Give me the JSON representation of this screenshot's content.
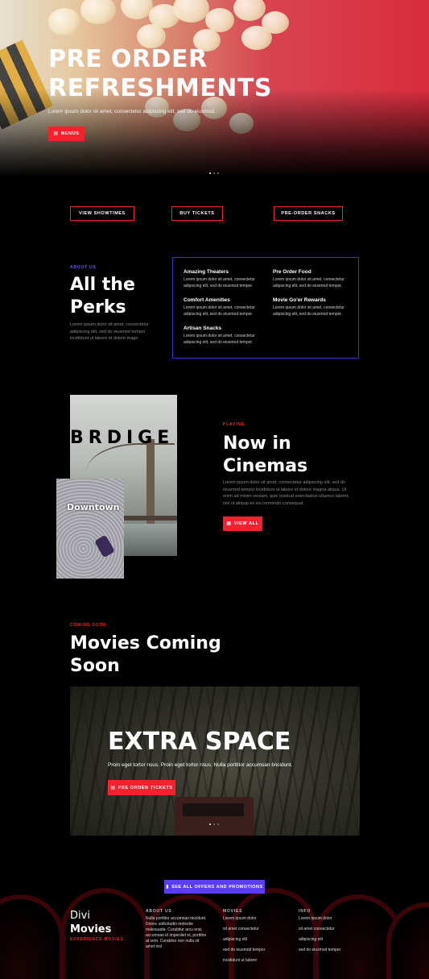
{
  "hero": {
    "title": "PRE ORDER REFRESHMENTS",
    "subtitle": "Lorem ipsum dolor sit amet, consectetur adipiscing elit, sed do eiusmod.",
    "button_label": "MENUS"
  },
  "quick_links": [
    "VIEW SHOWTIMES",
    "BUY TICKETS",
    "PRE-ORDER SNACKS"
  ],
  "perks": {
    "eyebrow": "ABOUT US",
    "title_light": "All the",
    "title_bold": "Perks",
    "description": "Lorem ipsum dolor sit amet, consectetur adipiscing elit, sed do eiusmod tempor incididunt ut labore et dolore magn",
    "items": [
      {
        "title": "Amazing Theaters",
        "text": "Lorem ipsum dolor sit amet, consectetur adipiscing elit, sed do eiusmod tempor."
      },
      {
        "title": "Pre Order Food",
        "text": "Lorem ipsum dolor sit amet, consectetur adipiscing elit, sed do eiusmod tempor."
      },
      {
        "title": "Comfort Amenities",
        "text": "Lorem ipsum dolor sit amet, consectetur adipiscing elit, sed do eiusmod tempor."
      },
      {
        "title": "Movie Go'er Rewards",
        "text": "Lorem ipsum dolor sit amet, consectetur adipiscing elit, sed do eiusmod tempor."
      },
      {
        "title": "Artisan Snacks",
        "text": "Lorem ipsum dolor sit amet, consectetur adipiscing elit, sed do eiusmod tempor."
      }
    ]
  },
  "cinemas": {
    "poster_bridge_word": "BRDIGE",
    "poster_downtown_word": "Downtown",
    "eyebrow": "PLAYING",
    "title_light": "Now in",
    "title_bold": "Cinemas",
    "description": "Lorem ipsum dolor sit amet, consectetur adipiscing elit, sed do eiusmod tempor incididunt ut labore et dolore magna aliqua. Ut enim ad minim veniam, quis nostrud exercitation ullamco laboris nisi ut aliquip ex ea commodo consequat.",
    "button_label": "VIEW ALL"
  },
  "coming_soon": {
    "eyebrow": "COMING SOON",
    "title_light": "Movies",
    "title_bold": "Coming Soon",
    "feature_title": "EXTRA SPACE",
    "feature_subtitle": "Proin eget tortor risus. Proin eget tortor risus. Nulla porttitor accumsan tincidunt.",
    "feature_button": "PRE ORDER TICKETS"
  },
  "footer": {
    "promo_button": "SEE ALL OFFERS AND PROMOTIONS",
    "brand_light": "Divi",
    "brand_bold": "Movies",
    "brand_tagline": "EXPERIENCE MOVIES",
    "about_title": "ABOUT US",
    "about_text": "Nulla porttitor accumsan tincidunt. Donec sollicitudin molestie malesuada. Curabitur arcu erat, accumsan id imperdiet et, porttitor at sem. Curabitur non nulla sit amet nisl",
    "movies_title": "MOVIES",
    "movies_links": [
      "Lorem ipsum dolor",
      "sit amet consectetur",
      "adipiscing elit",
      "sed do eiusmod tempor",
      "incididunt ut labore"
    ],
    "info_title": "INFO",
    "info_links": [
      "Lorem ipsum dolor",
      "sit amet consectetur",
      "adipiscing elit",
      "sed do eiusmod tempor"
    ]
  },
  "colors": {
    "accent_red": "#f5222d",
    "accent_purple": "#5b3cf0",
    "perks_border": "#3d2ed1",
    "eyebrow_purple": "#6a55ff",
    "background": "#000000"
  },
  "icons": {
    "menu_button_icon": "menu-icon",
    "view_all_icon": "grid-icon",
    "ticket_icon": "ticket-icon",
    "promo_icon": "bookmark-icon"
  }
}
